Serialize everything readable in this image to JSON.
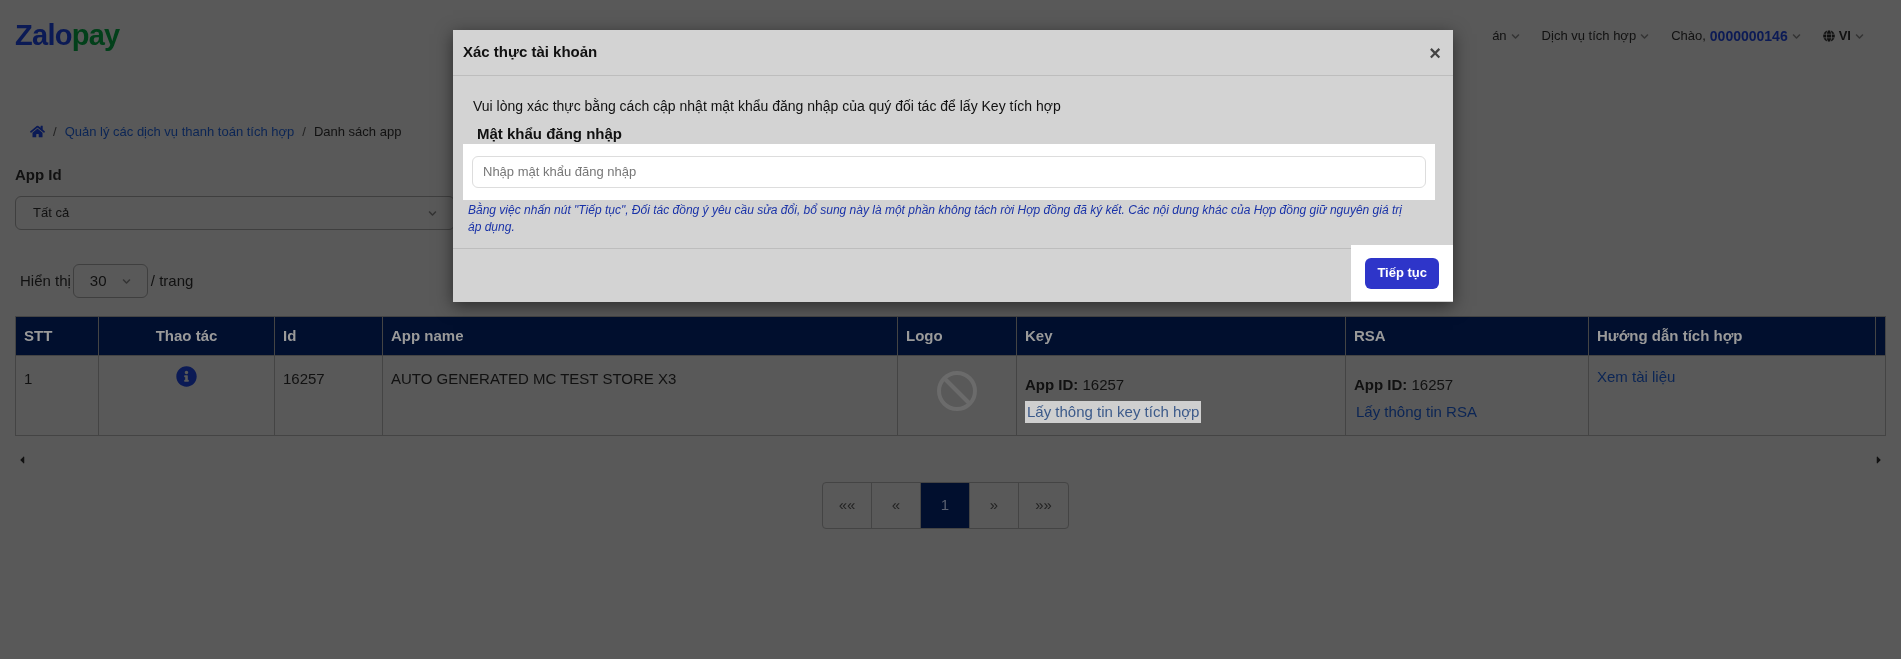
{
  "header": {
    "logo": [
      {
        "text": "Zalo",
        "color": "#0b1a55"
      },
      {
        "text": "pay",
        "color": "#02401a"
      }
    ],
    "nav": [
      {
        "label": "án",
        "kind": "menu"
      },
      {
        "label": "Dịch vụ tích hợp",
        "kind": "menu"
      },
      {
        "label": "Chào, ",
        "value": "0000000146",
        "kind": "user"
      },
      {
        "label": "VI",
        "kind": "language"
      }
    ]
  },
  "breadcrumb": [
    {
      "separator": "/",
      "label": "Quản lý các dịch vụ thanh toán tích hợp",
      "kind": "link"
    },
    {
      "separator": "/",
      "label": "Danh sách app",
      "kind": "current"
    }
  ],
  "filter": {
    "label": "App Id",
    "value": "Tất cả"
  },
  "page_size": {
    "before": "Hiển thị",
    "value": "30",
    "after": "/ trang"
  },
  "table": {
    "columns": [
      "STT",
      "Thao tác",
      "Id",
      "App name",
      "Logo",
      "Key",
      "RSA",
      "Hướng dẫn tích hợp"
    ],
    "rows": [
      {
        "stt": "1",
        "id": "16257",
        "app_name": "AUTO GENERATED MC TEST STORE X3",
        "key": {
          "label": "App ID:",
          "value": "16257",
          "link": "Lấy thông tin key tích hợp",
          "highlighted": true
        },
        "rsa": {
          "label": "App ID:",
          "value": "16257",
          "link": "Lấy thông tin RSA",
          "highlighted": false
        },
        "guide": "Xem tài liệu"
      }
    ]
  },
  "pagination": [
    {
      "label": "««",
      "selected": false
    },
    {
      "label": "«",
      "selected": false
    },
    {
      "label": "1",
      "selected": true
    },
    {
      "label": "»",
      "selected": false
    },
    {
      "label": "»»",
      "selected": false
    }
  ],
  "modal": {
    "title": "Xác thực tài khoản",
    "close": "×",
    "message": "Vui lòng xác thực bằng cách cập nhật mật khẩu đăng nhập của quý đối tác để lấy Key tích hợp",
    "field_label": "Mật khẩu đăng nhập",
    "placeholder": "Nhập mật khẩu đăng nhập",
    "note": "Bằng việc nhấn nút \"Tiếp tục\", Đối tác đồng ý yêu cầu sửa đổi, bổ sung này là một phần không tách rời Hợp đồng đã ký kết. Các nội dung khác của Hợp đồng giữ nguyên giá trị áp dụng.",
    "button": "Tiếp tục"
  }
}
